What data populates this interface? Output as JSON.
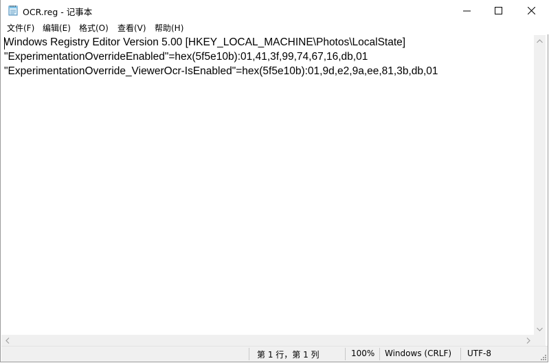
{
  "window": {
    "title": "OCR.reg - 记事本",
    "icon": "notepad-icon"
  },
  "menu": {
    "items": [
      "文件(F)",
      "编辑(E)",
      "格式(O)",
      "查看(V)",
      "帮助(H)"
    ]
  },
  "editor": {
    "lines": [
      "Windows Registry Editor Version 5.00 [HKEY_LOCAL_MACHINE\\Photos\\LocalState]",
      "\"ExperimentationOverrideEnabled\"=hex(5f5e10b):01,41,3f,99,74,67,16,db,01",
      "\"ExperimentationOverride_ViewerOcr-IsEnabled\"=hex(5f5e10b):01,9d,e2,9a,ee,81,3b,db,01"
    ]
  },
  "status": {
    "position": "第 1 行，第 1 列",
    "zoom": "100%",
    "line_ending": "Windows (CRLF)",
    "encoding": "UTF-8"
  }
}
